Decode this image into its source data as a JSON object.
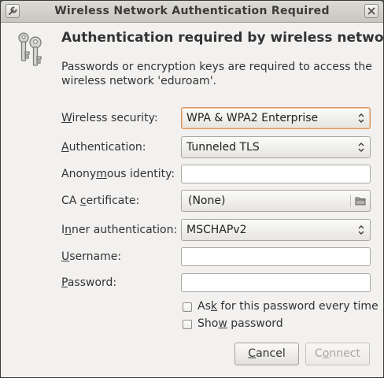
{
  "window": {
    "title": "Wireless Network Authentication Required"
  },
  "dialog": {
    "heading": "Authentication required by wireless network",
    "message": "Passwords or encryption keys are required to access the wireless network 'eduroam'."
  },
  "form": {
    "wireless_security": {
      "label_mn": "W",
      "label_rest": "ireless security:",
      "value": "WPA & WPA2 Enterprise"
    },
    "authentication": {
      "label_mn": "A",
      "label_rest": "uthentication:",
      "value": "Tunneled TLS"
    },
    "anonymous_identity": {
      "label_pre": "Anony",
      "label_mn": "m",
      "label_post": "ous identity:",
      "value": ""
    },
    "ca_certificate": {
      "label_pre": "CA ",
      "label_mn": "c",
      "label_post": "ertificate:",
      "value": "(None)"
    },
    "inner_authentication": {
      "label_pre": "I",
      "label_mn": "n",
      "label_post": "ner authentication:",
      "value": "MSCHAPv2"
    },
    "username": {
      "label_mn": "U",
      "label_rest": "sername:",
      "value": ""
    },
    "password": {
      "label_mn": "P",
      "label_rest": "assword:",
      "value": ""
    },
    "ask_password": {
      "label_pre": "As",
      "label_mn": "k",
      "label_post": " for this password every time",
      "checked": false
    },
    "show_password": {
      "label_pre": "Sho",
      "label_mn": "w",
      "label_post": " password",
      "checked": false
    }
  },
  "buttons": {
    "cancel": {
      "label_mn": "C",
      "label_rest": "ancel"
    },
    "connect": {
      "label_pre": "C",
      "label_mn": "o",
      "label_post": "nnect",
      "enabled": false
    }
  },
  "icons": {
    "window_menu": "wrench-icon",
    "close": "close-icon",
    "dialog": "keys-icon",
    "combo_arrows": "updown-arrows-icon",
    "file_chooser": "folder-icon"
  },
  "colors": {
    "window_bg": "#f2f1f0",
    "titlebar": "#d4d2cc",
    "focus_ring": "#d8935a"
  }
}
